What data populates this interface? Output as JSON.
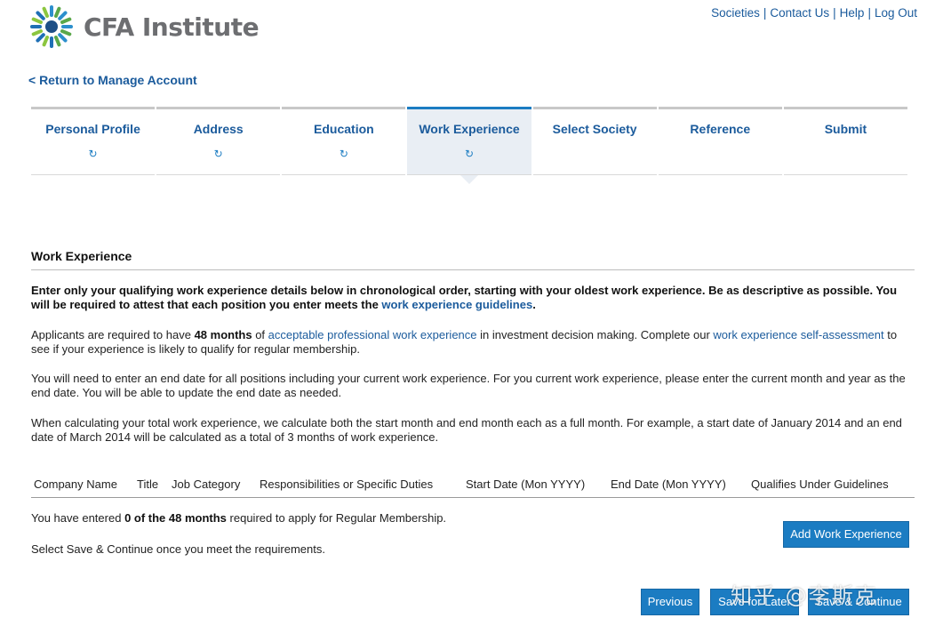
{
  "brand": {
    "name": "CFA Institute"
  },
  "toplinks": [
    "Societies",
    "Contact Us",
    "Help",
    "Log Out"
  ],
  "return_link": "< Return to Manage Account",
  "steps": [
    {
      "label": "Personal Profile",
      "icon": "refresh-icon",
      "icon_glyph": "↻"
    },
    {
      "label": "Address",
      "icon": "refresh-icon",
      "icon_glyph": "↻"
    },
    {
      "label": "Education",
      "icon": "refresh-icon",
      "icon_glyph": "↻"
    },
    {
      "label": "Work Experience",
      "icon": "refresh-icon",
      "icon_glyph": "↻"
    },
    {
      "label": "Select Society"
    },
    {
      "label": "Reference"
    },
    {
      "label": "Submit"
    }
  ],
  "section_title": "Work Experience",
  "intro": {
    "text": "Enter only your qualifying work experience details below in chronological order, starting with your oldest work experience. Be as descriptive as possible. You will be required to attest that each position you enter meets the ",
    "link": "work experience guidelines",
    "end": "."
  },
  "para2": {
    "t1": "Applicants are required to have ",
    "bold": "48 months",
    "t2": " of ",
    "link1": "acceptable professional work experience",
    "t3": " in investment decision making. Complete our ",
    "link2": "work experience self-assessment",
    "t4": " to see if your experience is likely to qualify for regular membership."
  },
  "para3": "You will need to enter an end date for all positions including your current work experience. For you current work experience, please enter the current month and year as the end date. You will be able to update the end date as needed.",
  "para4": "When calculating your total work experience, we calculate both the start month and end month each as a full month. For example, a start date of January 2014 and an end date of March 2014 will be calculated as a total of 3 months of work experience.",
  "table": {
    "columns": [
      "Company Name",
      "Title",
      "Job Category",
      "Responsibilities or Specific Duties",
      "Start Date (Mon YYYY)",
      "End Date (Mon YYYY)",
      "Qualifies Under Guidelines"
    ]
  },
  "status": {
    "t1": "You have entered ",
    "bold": "0 of the 48 months",
    "t2": " required to apply for Regular Membership."
  },
  "instruction": "Select Save & Continue once you meet the requirements.",
  "buttons": {
    "add": "Add Work Experience",
    "previous": "Previous",
    "save_later": "Save for Later",
    "save_continue": "Save & Continue"
  },
  "watermark": "知乎 @李斯克",
  "colors": {
    "link": "#1b5b9c",
    "button": "#1b7cc2",
    "active_tab_bg": "#e9eef4"
  }
}
